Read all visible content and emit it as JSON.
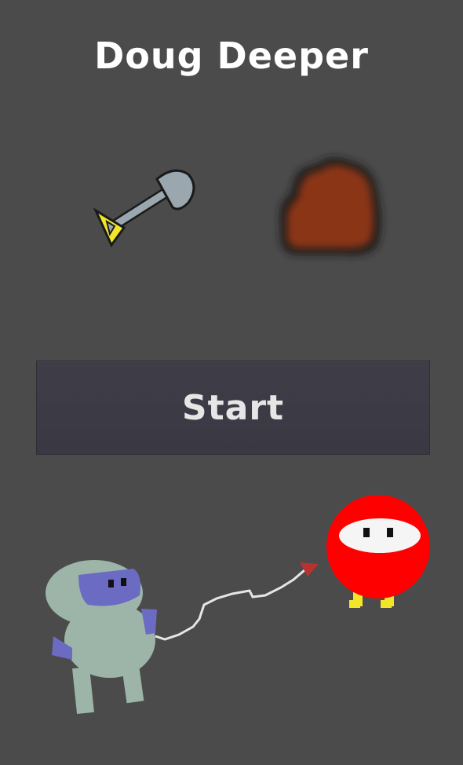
{
  "title": "Doug Deeper",
  "start_button": {
    "label": "Start"
  },
  "colors": {
    "background": "#4b4b4b",
    "button": "#3d3b45",
    "player_body": "#9db5a8",
    "player_visor": "#6b6bc4",
    "enemy": "#ff0000",
    "enemy_feet": "#f2e62a",
    "shovel_handle": "#9aa7ae",
    "shovel_grip": "#f2e62a",
    "dirt": "#8a3414"
  },
  "icons": {
    "shovel": "shovel-icon",
    "dirt": "dirt-block-icon",
    "player": "doug-player-sprite",
    "enemy": "red-enemy-sprite"
  }
}
